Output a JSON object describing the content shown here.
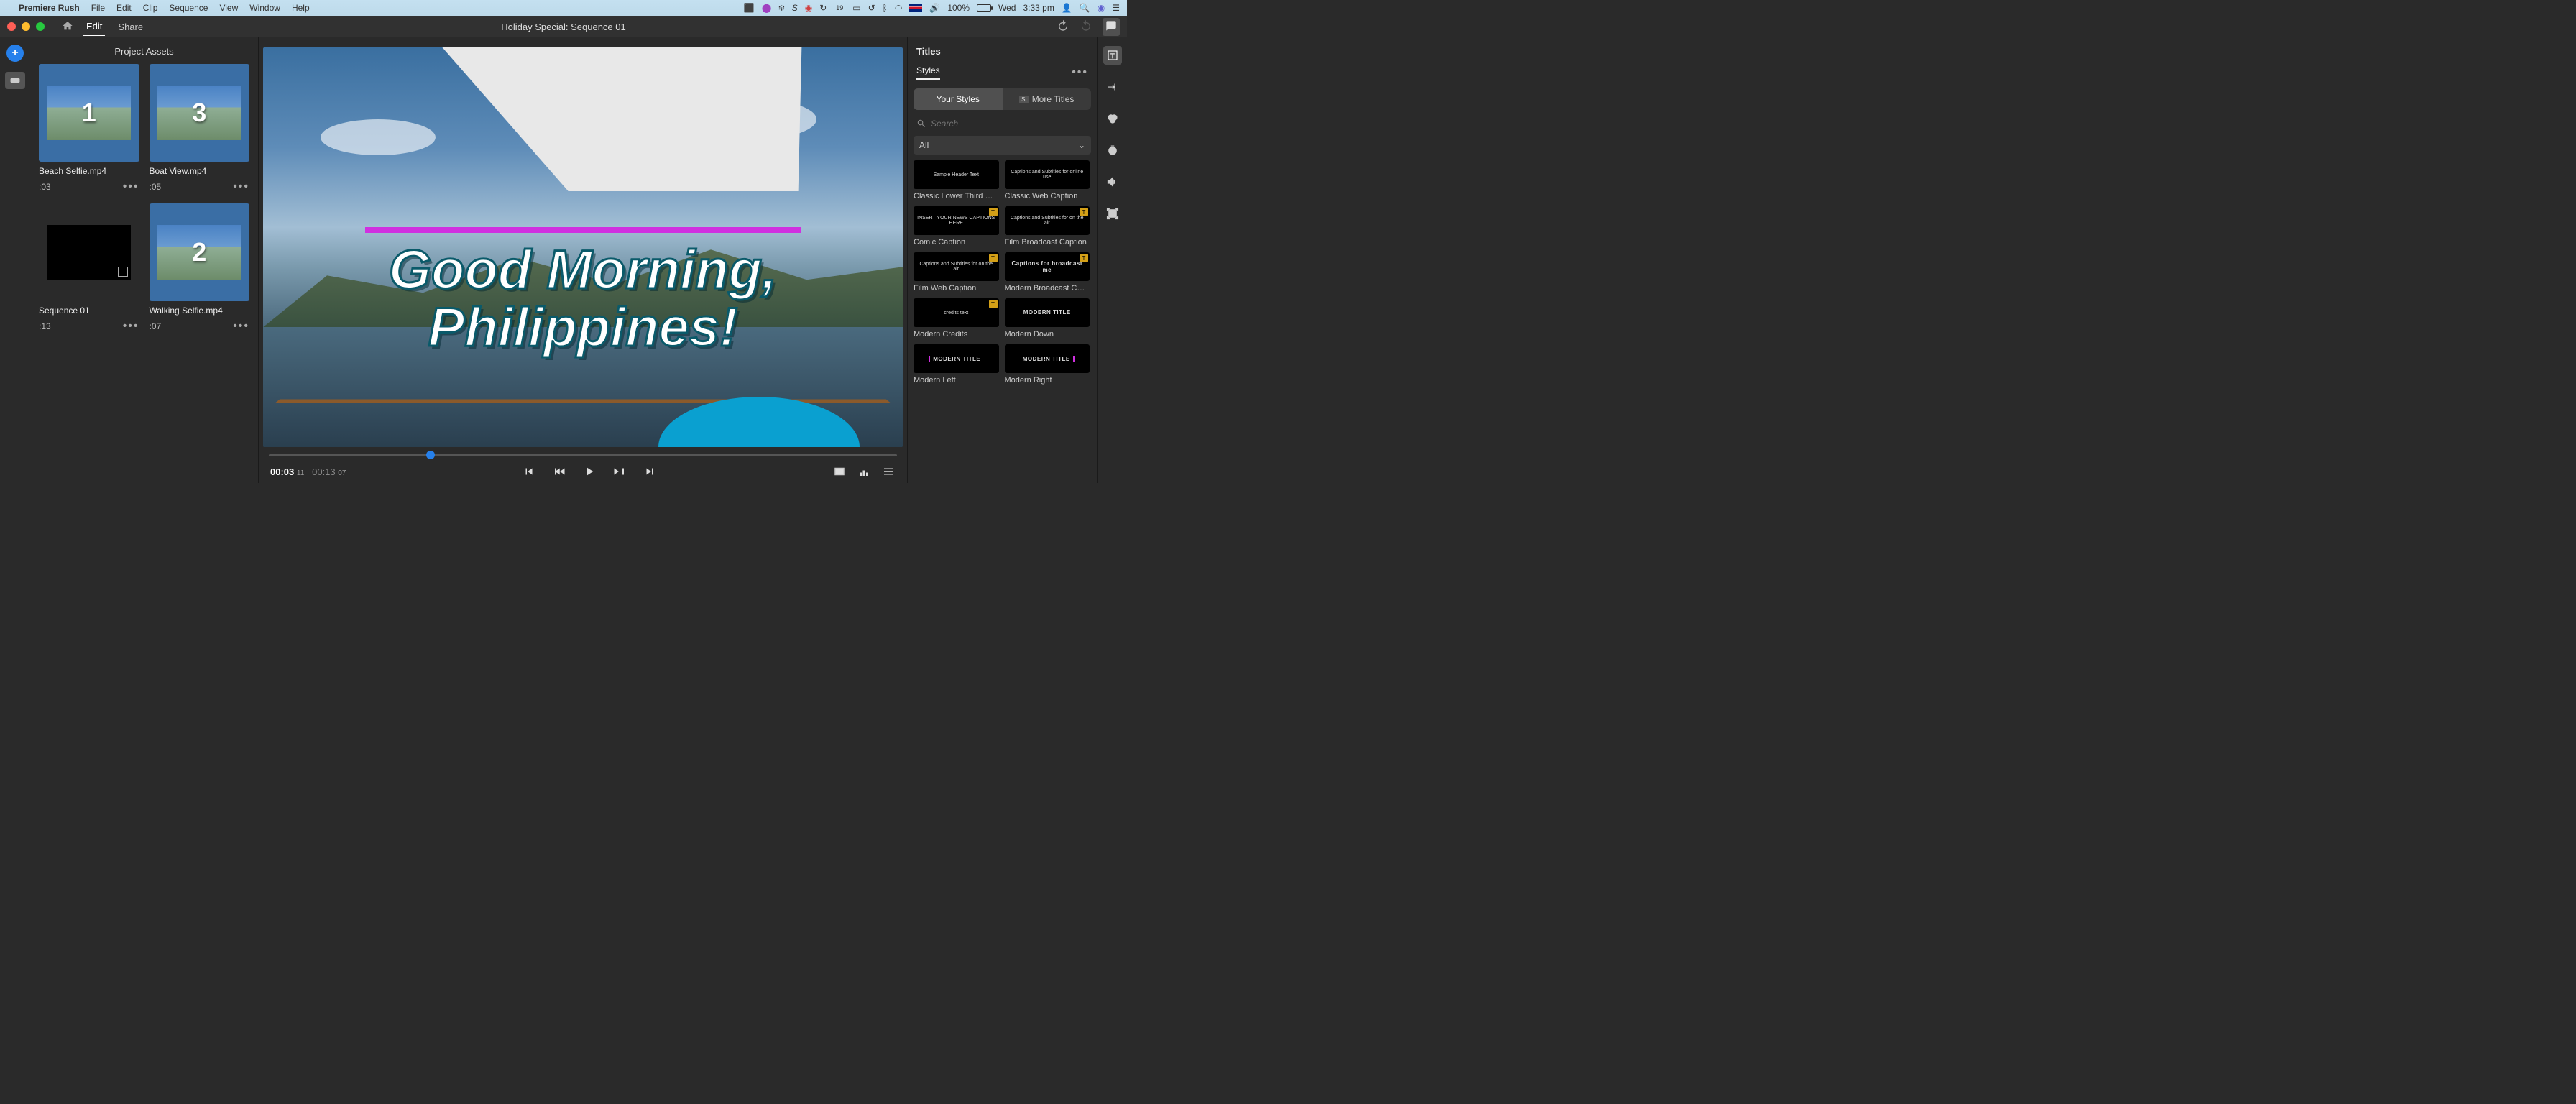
{
  "menubar": {
    "app": "Premiere Rush",
    "items": [
      "File",
      "Edit",
      "Clip",
      "Sequence",
      "View",
      "Window",
      "Help"
    ],
    "battery": "100%",
    "day": "Wed",
    "time": "3:33 pm",
    "calendar_day": "19"
  },
  "toolbar": {
    "edit": "Edit",
    "share": "Share",
    "title": "Holiday Special: Sequence 01"
  },
  "assets": {
    "title": "Project Assets",
    "items": [
      {
        "name": "Beach Selfie.mp4",
        "dur": ":03",
        "num": "1",
        "black": false
      },
      {
        "name": "Boat View.mp4",
        "dur": ":05",
        "num": "3",
        "black": false
      },
      {
        "name": "Sequence 01",
        "dur": ":13",
        "num": "",
        "black": true
      },
      {
        "name": "Walking Selfie.mp4",
        "dur": ":07",
        "num": "2",
        "black": false
      }
    ]
  },
  "preview": {
    "title_text": "Good Morning,\nPhilippines!"
  },
  "transport": {
    "current": "00:03",
    "current_ms": "11",
    "total": "00:13",
    "total_ms": "07",
    "scrub_pct": 25
  },
  "titles_panel": {
    "heading": "Titles",
    "styles_label": "Styles",
    "tabs": {
      "your": "Your Styles",
      "more": "More Titles"
    },
    "search_placeholder": "Search",
    "filter": "All",
    "items": [
      {
        "name": "Classic Lower Third …",
        "gold": false,
        "text": "Sample Header Text"
      },
      {
        "name": "Classic Web Caption",
        "gold": false,
        "text": "Captions and Subtitles for online use"
      },
      {
        "name": "Comic Caption",
        "gold": true,
        "text": "INSERT YOUR NEWS CAPTIONS HERE"
      },
      {
        "name": "Film Broadcast Caption",
        "gold": true,
        "text": "Captions and Subtitles for on the air"
      },
      {
        "name": "Film Web Caption",
        "gold": true,
        "text": "Captions and Subtitles for on the air"
      },
      {
        "name": "Modern Broadcast C…",
        "gold": true,
        "text": "Captions for broadcast me"
      },
      {
        "name": "Modern Credits",
        "gold": true,
        "text": "credits text"
      },
      {
        "name": "Modern Down",
        "gold": false,
        "text": "MODERN TITLE"
      },
      {
        "name": "Modern Left",
        "gold": false,
        "text": "MODERN TITLE"
      },
      {
        "name": "Modern Right",
        "gold": false,
        "text": "MODERN TITLE"
      }
    ]
  }
}
